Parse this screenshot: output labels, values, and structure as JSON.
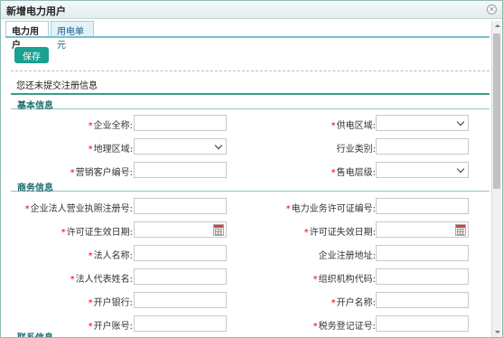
{
  "window": {
    "title": "新增电力用户",
    "close_icon": "close-icon"
  },
  "tabs": [
    {
      "label": "电力用户",
      "active": true
    },
    {
      "label": "用电单元",
      "active": false
    }
  ],
  "toolbar": {
    "save_label": "保存"
  },
  "notice": "您还未提交注册信息",
  "sections": {
    "basic": "基本信息",
    "business": "商务信息",
    "contact": "联系信息"
  },
  "basic": {
    "company_name": {
      "label": "企业全称:",
      "required": true,
      "value": ""
    },
    "supply_area": {
      "label": "供电区域:",
      "required": true,
      "type": "select",
      "value": ""
    },
    "geo_area": {
      "label": "地理区域:",
      "required": true,
      "type": "select",
      "value": ""
    },
    "industry": {
      "label": "行业类别:",
      "required": false,
      "value": ""
    },
    "marketing_no": {
      "label": "营销客户编号:",
      "required": true,
      "value": ""
    },
    "sale_level": {
      "label": "售电层级:",
      "required": true,
      "type": "select",
      "value": ""
    }
  },
  "business": {
    "license_no": {
      "label": "企业法人营业执照注册号:",
      "required": true,
      "value": ""
    },
    "power_permit_no": {
      "label": "电力业务许可证编号:",
      "required": true,
      "value": ""
    },
    "permit_start": {
      "label": "许可证生效日期:",
      "required": true,
      "type": "date",
      "value": ""
    },
    "permit_end": {
      "label": "许可证失效日期:",
      "required": true,
      "type": "date",
      "value": ""
    },
    "legal_name": {
      "label": "法人名称:",
      "required": true,
      "value": ""
    },
    "reg_address": {
      "label": "企业注册地址:",
      "required": false,
      "value": ""
    },
    "legal_rep": {
      "label": "法人代表姓名:",
      "required": true,
      "value": ""
    },
    "org_code": {
      "label": "组织机构代码:",
      "required": true,
      "value": ""
    },
    "bank": {
      "label": "开户银行:",
      "required": true,
      "value": ""
    },
    "account_name": {
      "label": "开户名称:",
      "required": true,
      "value": ""
    },
    "account_no": {
      "label": "开户账号:",
      "required": true,
      "value": ""
    },
    "tax_reg_no": {
      "label": "税务登记证号:",
      "required": true,
      "value": ""
    }
  },
  "colors": {
    "accent": "#1aa18f",
    "required_star": "#e00000",
    "section_text": "#1f6d6d"
  }
}
